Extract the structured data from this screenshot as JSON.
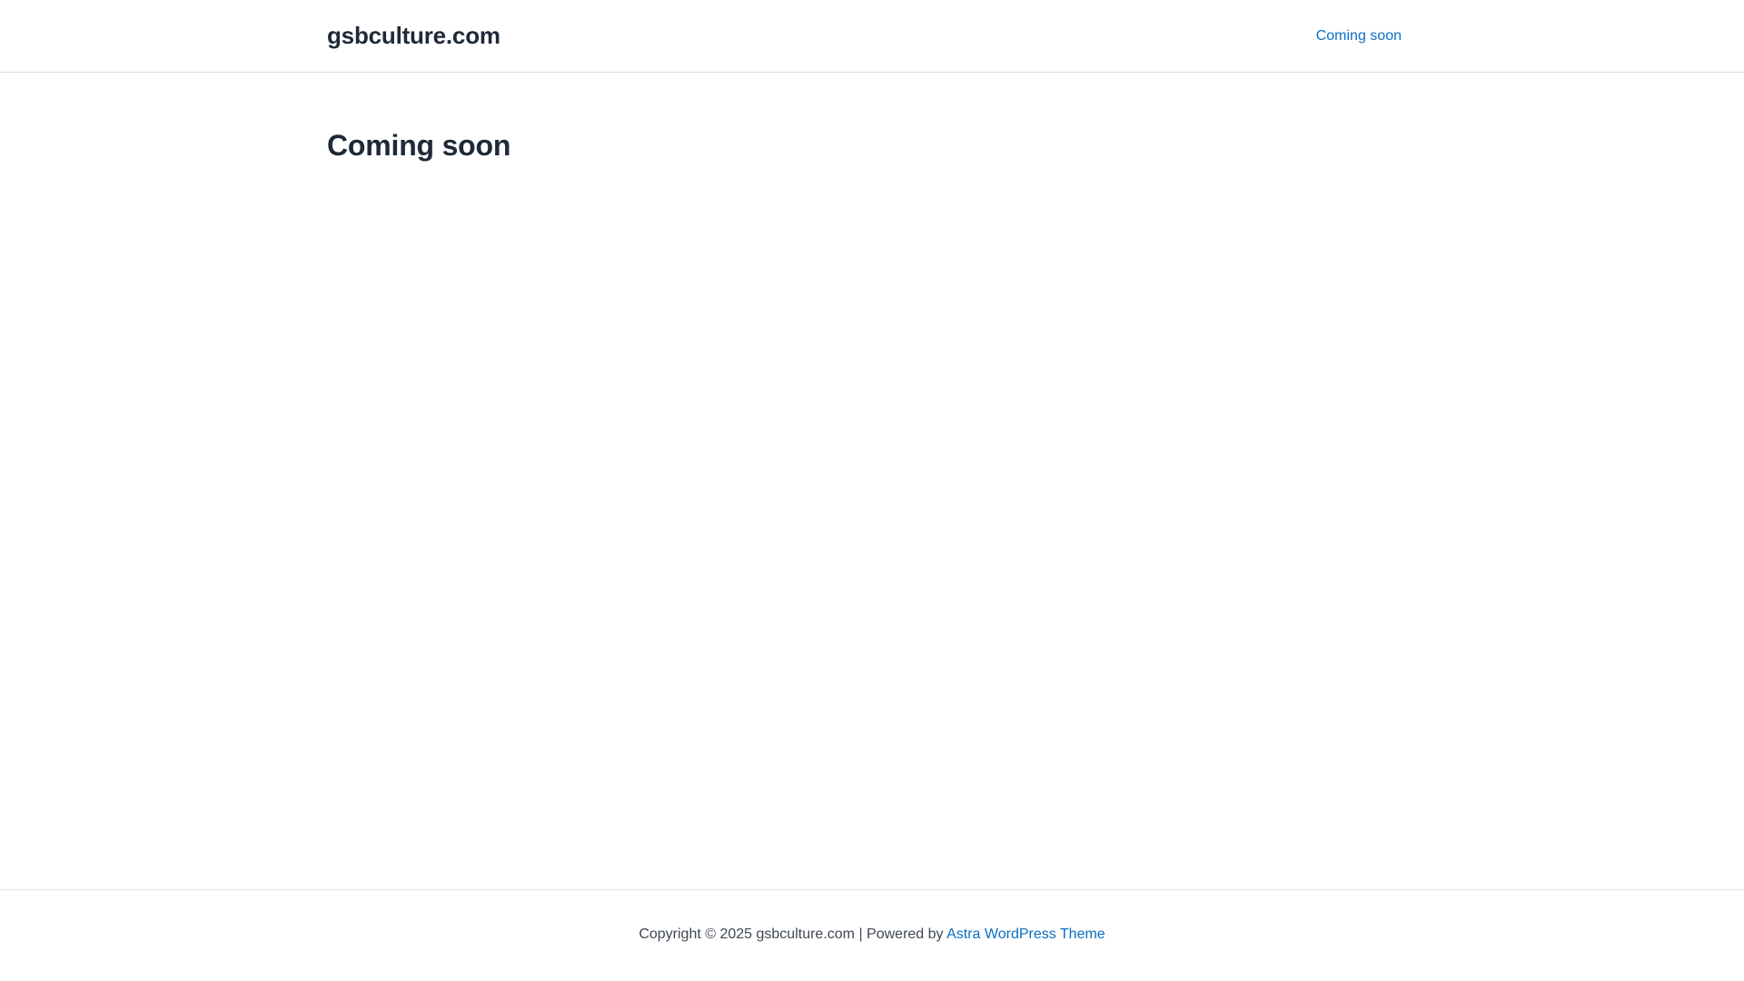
{
  "header": {
    "site_title": "gsbculture.com",
    "nav": [
      {
        "label": "Coming soon"
      }
    ]
  },
  "main": {
    "page_title": "Coming soon"
  },
  "footer": {
    "copyright_text": "Copyright © 2025 gsbculture.com | Powered by ",
    "theme_link_label": "Astra WordPress Theme"
  },
  "colors": {
    "link": "#0b6ec2",
    "heading": "#1f2937",
    "body_text": "#3f4753",
    "border": "#dcdfe3"
  }
}
